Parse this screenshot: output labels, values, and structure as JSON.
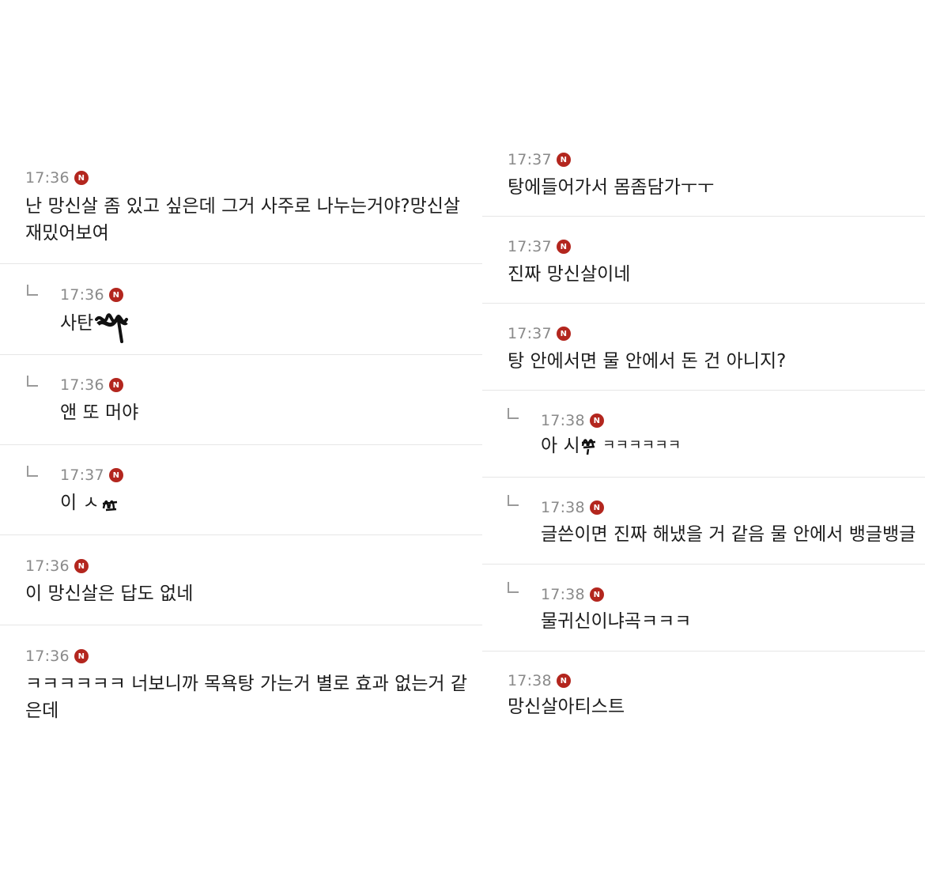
{
  "left_comments": [
    {
      "time": "17:36",
      "badge": "N",
      "text": "난 망신살 좀 있고 싶은데 그거 사주로 나누는거야?망신살 재밌어보여",
      "is_reply": false
    },
    {
      "time": "17:36",
      "badge": "N",
      "text": "사탄",
      "is_reply": true,
      "censored": true
    },
    {
      "time": "17:36",
      "badge": "N",
      "text": "앤 또 머야",
      "is_reply": true
    },
    {
      "time": "17:37",
      "badge": "N",
      "text": "이 ㅅ",
      "is_reply": true,
      "censored": true
    },
    {
      "time": "17:36",
      "badge": "N",
      "text": "이 망신살은 답도 없네",
      "is_reply": false
    },
    {
      "time": "17:36",
      "badge": "N",
      "text": "ㅋㅋㅋㅋㅋㅋ 너보니까 목욕탕 가는거 별로 효과 없는거 같은데",
      "is_reply": false
    }
  ],
  "right_comments": [
    {
      "time": "17:37",
      "badge": "N",
      "text": "탕에들어가서 몸좀담가ㅜㅜ",
      "is_reply": false
    },
    {
      "time": "17:37",
      "badge": "N",
      "text": "진짜 망신살이네",
      "is_reply": false
    },
    {
      "time": "17:37",
      "badge": "N",
      "text": "탕 안에서면 물 안에서 돈 건 아니지?",
      "is_reply": false
    },
    {
      "time": "17:38",
      "badge": "N",
      "text": "아 시",
      "text_after": "ㅋㅋㅋㅋㅋㅋ",
      "is_reply": true,
      "censored": true
    },
    {
      "time": "17:38",
      "badge": "N",
      "text": "글쓴이면 진짜 해냈을 거 같음 물 안에서 뱅글뱅글",
      "is_reply": true
    },
    {
      "time": "17:38",
      "badge": "N",
      "text": "물귀신이냐곡ㅋㅋㅋ",
      "is_reply": true
    },
    {
      "time": "17:38",
      "badge": "N",
      "text": "망신살아티스트",
      "is_reply": false
    }
  ],
  "colors": {
    "badge": "#b3261e",
    "time": "#8a8a8a",
    "divider": "#e6e6e6"
  }
}
